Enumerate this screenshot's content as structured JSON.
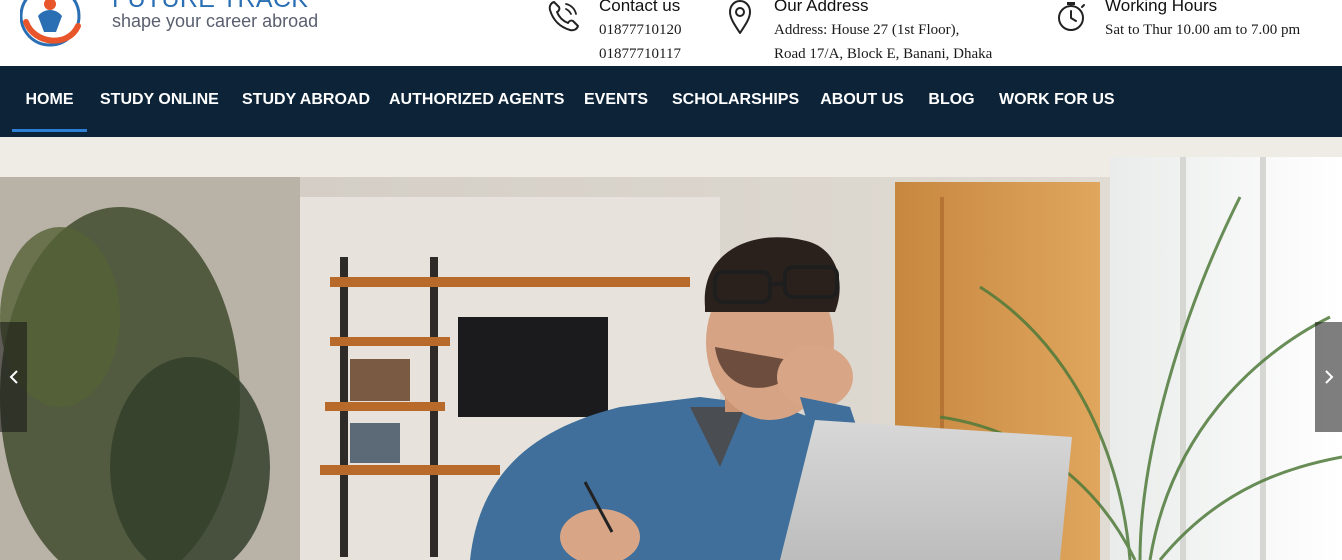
{
  "brand": {
    "name": "FUTURE TRACK",
    "tagline": "shape your career abroad",
    "logo_icon": "future-track-logo"
  },
  "contact": {
    "icon": "phone-icon",
    "title": "Contact us",
    "phone_1": "01877710120",
    "phone_2": "01877710117"
  },
  "address": {
    "icon": "map-pin-icon",
    "title": "Our Address",
    "line_1": "Address: House 27 (1st Floor),",
    "line_2": "Road 17/A, Block E, Banani, Dhaka"
  },
  "hours": {
    "icon": "stopwatch-icon",
    "title": "Working Hours",
    "line_1": "Sat to Thur 10.00 am to 7.00 pm"
  },
  "nav": {
    "items": [
      {
        "label": "HOME",
        "active": true
      },
      {
        "label": "STUDY ONLINE",
        "active": false
      },
      {
        "label": "STUDY ABROAD",
        "active": false
      },
      {
        "label": "AUTHORIZED AGENTS",
        "active": false
      },
      {
        "label": "EVENTS",
        "active": false
      },
      {
        "label": "SCHOLARSHIPS",
        "active": false
      },
      {
        "label": "ABOUT US",
        "active": false
      },
      {
        "label": "BLOG",
        "active": false
      },
      {
        "label": "WORK FOR US",
        "active": false
      }
    ]
  },
  "slider": {
    "prev_icon": "chevron-left-icon",
    "next_icon": "chevron-right-icon"
  },
  "colors": {
    "nav_background": "#0c2338",
    "active_underline": "#2d7fd4",
    "brand_blue": "#2a6fb3",
    "brand_orange": "#e8552a"
  }
}
